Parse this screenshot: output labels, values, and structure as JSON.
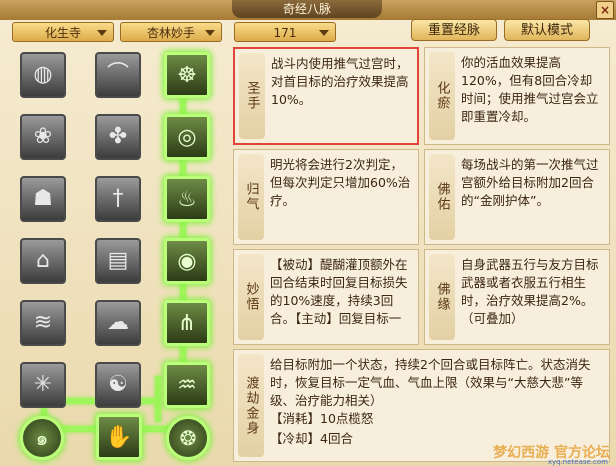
{
  "window": {
    "title": "奇经八脉",
    "close_label": "×"
  },
  "dropdowns": [
    {
      "value": "化生寺"
    },
    {
      "value": "杏林妙手"
    },
    {
      "value": "171"
    }
  ],
  "buttons": {
    "reset": "重置经脉",
    "default": "默认模式"
  },
  "grid_icons": [
    [
      "rock-icon",
      "rainbow-icon",
      "warrior-icon"
    ],
    [
      "lotus-icon",
      "cross-seal-icon",
      "ring-icon"
    ],
    [
      "buddha-icon",
      "sword-icon",
      "fire-icon"
    ],
    [
      "temple-icon",
      "book-icon",
      "jade-icon"
    ],
    [
      "bamboo-icon",
      "cloud-icon",
      "grass-icon"
    ],
    [
      "branch-icon",
      "orb-icon",
      "wave-icon"
    ]
  ],
  "bottom_icons": [
    "spiral-icon",
    "hand-icon",
    "swirl-icon"
  ],
  "cards": [
    {
      "name": "圣手",
      "text": "战斗内使用推气过宫时，对首目标的治疗效果提高10%。"
    },
    {
      "name": "化瘀",
      "text": "你的活血效果提高120%，但有8回合冷却时间；使用推气过宫会立即重置冷却。"
    },
    {
      "name": "归气",
      "text": "明光将会进行2次判定，但每次判定只增加60%治疗。"
    },
    {
      "name": "佛佑",
      "text": "每场战斗的第一次推气过宫额外给目标附加2回合的“金刚护体”。"
    },
    {
      "name": "妙悟",
      "text": "【被动】醍醐灌顶额外在回合结束时回复目标损失的10%速度，持续3回合。【主动】回复目标一"
    },
    {
      "name": "佛缘",
      "text": "自身武器五行与友方目标武器或者衣服五行相生时，治疗效果提高2%。（可叠加）"
    },
    {
      "name": "渡劫金身",
      "text": "给目标附加一个状态，持续2个回合或目标阵亡。状态消失时，恢复目标一定气血、气血上限（效果与“大慈大悲”等级、治疗能力相关）"
    },
    {
      "name": "",
      "text": "【消耗】10点榄怒"
    },
    {
      "name": "",
      "text": "【冷却】4回合"
    }
  ],
  "watermark": {
    "logo": "梦幻西游 官方论坛",
    "url": "xyq.netease.com"
  },
  "colors": {
    "accent": "#b9ff7a",
    "highlight": "#e0443a",
    "frame": "#a57a35"
  }
}
